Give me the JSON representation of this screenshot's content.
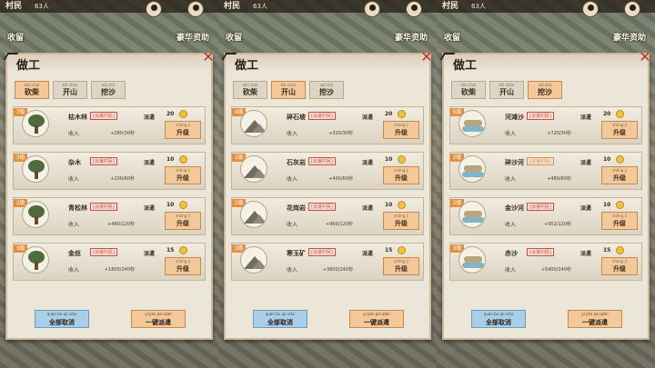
{
  "topbar": {
    "villager_label": "村民",
    "villager_count": "63人"
  },
  "map_labels": {
    "left": "收留",
    "right": "豪华资助"
  },
  "panel": {
    "title": "做工"
  },
  "tabs": [
    {
      "label": "砍柴",
      "pinyin": "kǎn chái"
    },
    {
      "label": "开山",
      "pinyin": "kāi shān"
    },
    {
      "label": "挖沙",
      "pinyin": "wā shā"
    }
  ],
  "buttons": {
    "upgrade": "升级",
    "upgrade_pinyin": "shēng jí",
    "cancel_all": "全部取消",
    "cancel_all_pinyin": "quán bù qǔ xiāo",
    "dispatch_all": "一键派遣",
    "dispatch_all_pinyin": "yí jiàn pài qiǎn"
  },
  "row_common": {
    "income_label": "收入",
    "dispatch_label": "派遣"
  },
  "colors": {
    "active_tab": "#f3c99a",
    "cancel_button": "#a9cfe8",
    "level_badge": "#e58f3d"
  },
  "screens": [
    {
      "active_tab": 0,
      "jobs": [
        {
          "level": "7级",
          "name": "枯木林",
          "tag": "[派遣村民]",
          "rate": "+280/30秒",
          "cost": "20",
          "icon": "tree-icon"
        },
        {
          "level": "3级",
          "name": "杂木",
          "tag": "[派遣村民]",
          "rate": "+200/60秒",
          "cost": "10",
          "icon": "tree-icon"
        },
        {
          "level": "2级",
          "name": "青松林",
          "tag": "[派遣村民]",
          "rate": "+480/120秒",
          "cost": "10",
          "icon": "tree-icon"
        },
        {
          "level": "3级",
          "name": "金丝",
          "tag": "[派遣村民]",
          "rate": "+1800/240秒",
          "cost": "15",
          "icon": "tree-icon"
        }
      ]
    },
    {
      "active_tab": 1,
      "jobs": [
        {
          "level": "4级",
          "name": "碎石坡",
          "tag": "[派遣村民]",
          "rate": "+320/30秒",
          "cost": "20",
          "icon": "mountain-icon"
        },
        {
          "level": "2级",
          "name": "石灰岩",
          "tag": "[派遣村民]",
          "rate": "+400/60秒",
          "cost": "10",
          "icon": "mountain-icon"
        },
        {
          "level": "2级",
          "name": "花岗岩",
          "tag": "[派遣村民]",
          "rate": "+960/120秒",
          "cost": "10",
          "icon": "mountain-icon"
        },
        {
          "level": "3级",
          "name": "寒玉矿",
          "tag": "[派遣村民]",
          "rate": "+3600/240秒",
          "cost": "15",
          "icon": "mountain-icon"
        }
      ]
    },
    {
      "active_tab": 2,
      "jobs": [
        {
          "level": "6级",
          "name": "河滩沙",
          "tag": "[派遣村民]",
          "rate": "+720/30秒",
          "cost": "20",
          "icon": "river-icon"
        },
        {
          "level": "2级",
          "name": "碎沙河",
          "tag": "[派遣村民]",
          "tag_style": "orange",
          "rate": "+480/60秒",
          "cost": "10",
          "icon": "river-icon"
        },
        {
          "level": "2级",
          "name": "金沙河",
          "tag": "[派遣村民]",
          "rate": "+952/120秒",
          "cost": "10",
          "icon": "river-icon"
        },
        {
          "level": "3级",
          "name": "赤沙",
          "tag": "[派遣村民]",
          "rate": "+5400/240秒",
          "cost": "15",
          "icon": "river-icon"
        }
      ]
    }
  ]
}
